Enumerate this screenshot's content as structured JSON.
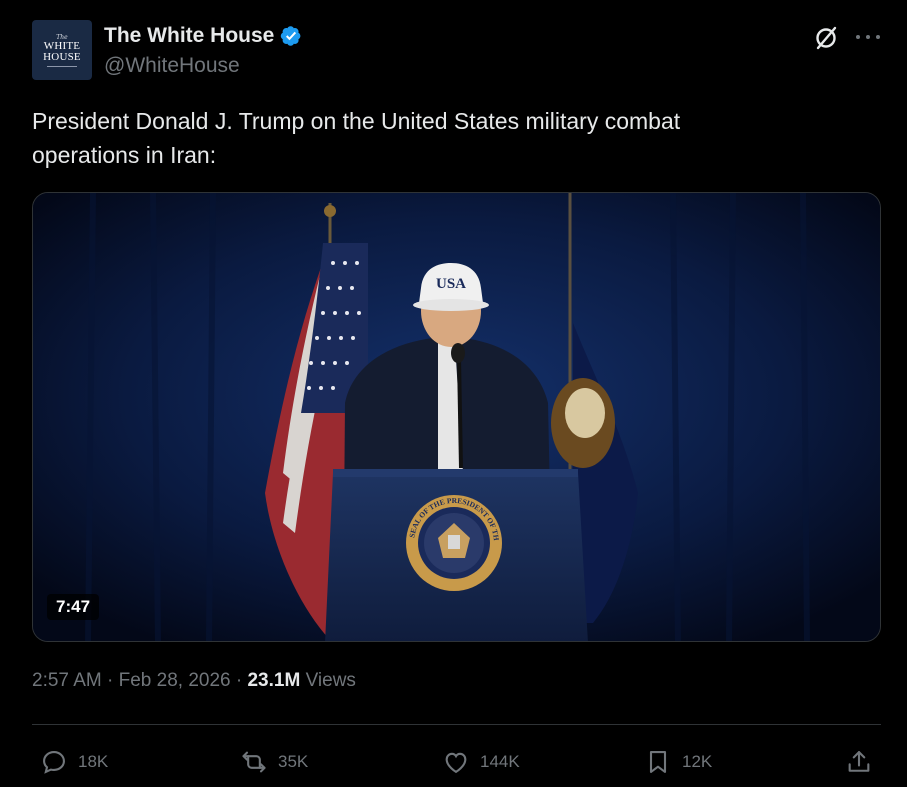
{
  "author": {
    "avatar_line1": "The",
    "avatar_line2": "WHITE",
    "avatar_line3": "HOUSE",
    "display_name": "The White House",
    "verified": true,
    "handle": "@WhiteHouse"
  },
  "header_icons": [
    "grok-icon",
    "more-icon"
  ],
  "tweet": {
    "text": "President Donald J. Trump on the United States military combat operations in Iran:"
  },
  "media": {
    "type": "video",
    "duration": "7:47",
    "cap_text": "USA",
    "seal_text": "SEAL OF THE PRESIDENT OF THE UNITED STATES"
  },
  "meta": {
    "time": "2:57 AM",
    "sep1": " · ",
    "date": "Feb 28, 2026",
    "sep2": " · ",
    "views_count": "23.1M",
    "views_label": " Views"
  },
  "actions": {
    "reply_count": "18K",
    "retweet_count": "35K",
    "like_count": "144K",
    "bookmark_count": "12K"
  },
  "colors": {
    "background": "#000000",
    "text": "#e7e9ea",
    "secondary": "#71767b",
    "verified": "#1d9bf0",
    "border": "#2f3336"
  }
}
